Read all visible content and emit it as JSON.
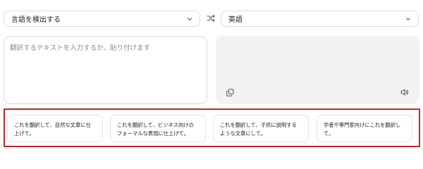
{
  "source_language": {
    "label": "言語を検出する",
    "icon": "chevron-down-icon"
  },
  "swap_button": {
    "icon": "swap-languages-icon"
  },
  "target_language": {
    "label": "英語",
    "icon": "chevron-down-icon"
  },
  "source_input": {
    "placeholder": "翻訳するテキストを入力するか、貼り付けます",
    "value": ""
  },
  "target_output": {
    "copy_icon": "copy-icon",
    "speaker_icon": "speaker-icon"
  },
  "suggestions": [
    {
      "label": "これを翻訳して、自然な文章に仕上げて。"
    },
    {
      "label": "これを翻訳して、ビジネス向けのフォーマルな表現に仕上げて。"
    },
    {
      "label": "これを翻訳して、子供に説明するような文章にして。"
    },
    {
      "label": "学者や専門家向けにこれを翻訳して。"
    }
  ],
  "colors": {
    "highlight_border": "#c0282d",
    "output_background": "#f2f2f2"
  }
}
